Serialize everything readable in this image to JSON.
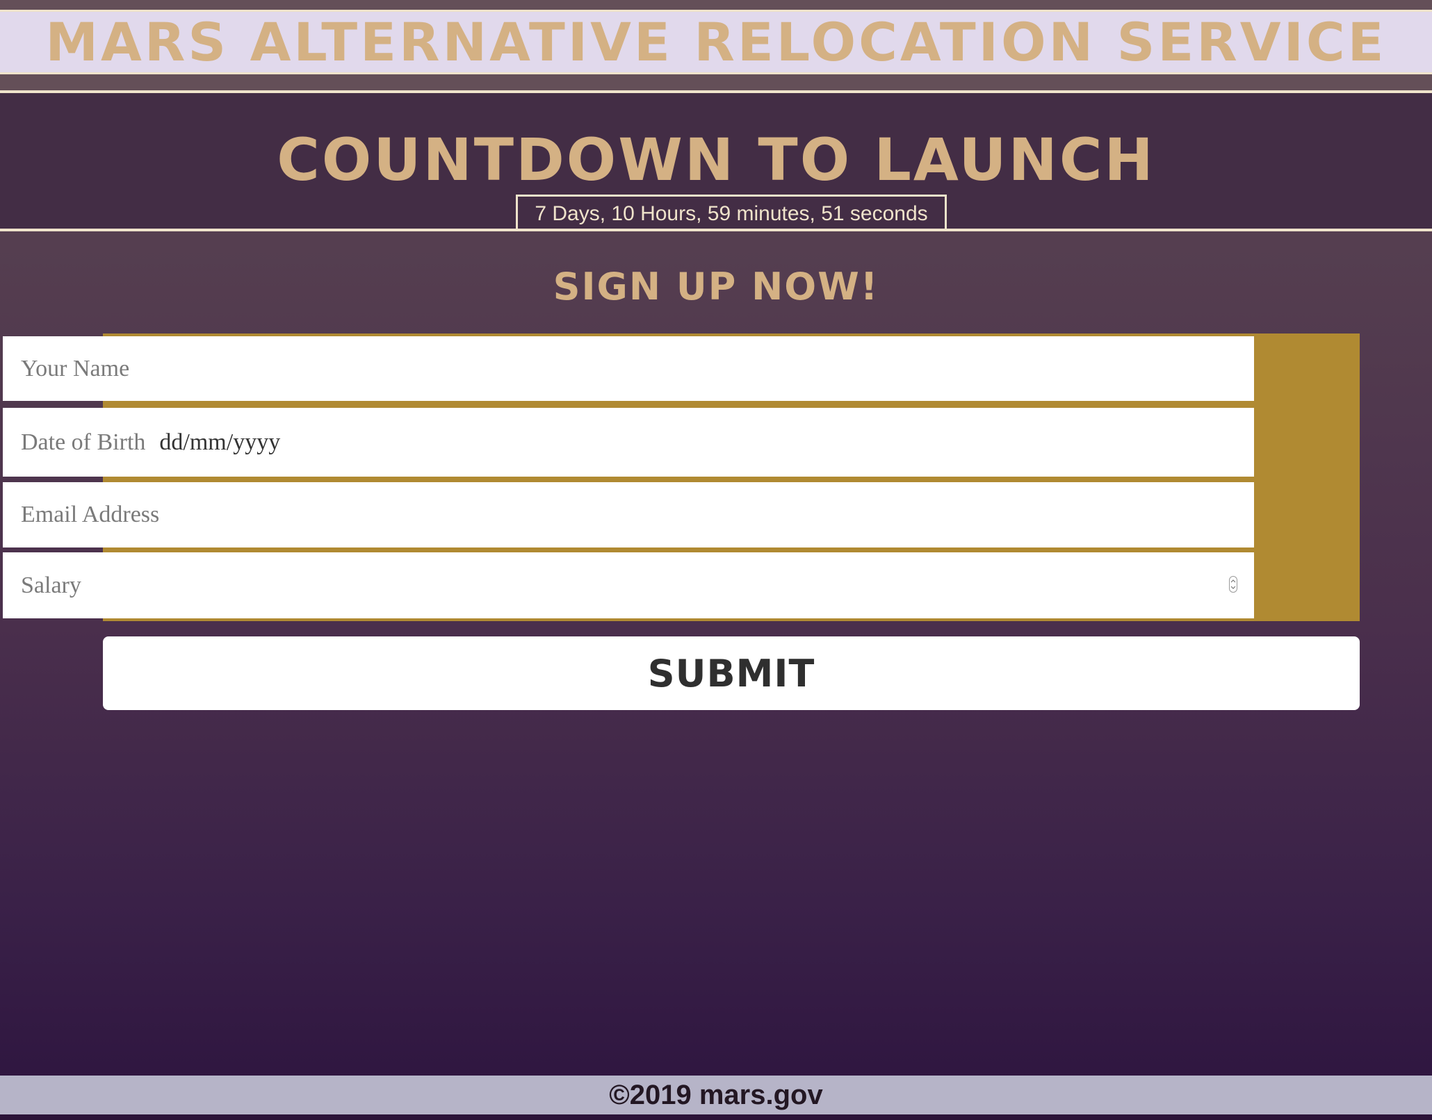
{
  "header": {
    "title": "MARS ALTERNATIVE RELOCATION SERVICE"
  },
  "countdown": {
    "title": "COUNTDOWN TO LAUNCH",
    "timer": "7 Days, 10 Hours, 59 minutes, 51 seconds"
  },
  "signup": {
    "title": "SIGN UP NOW!",
    "fields": {
      "name_placeholder": "Your Name",
      "dob_label": "Date of Birth",
      "dob_format": "dd/mm/yyyy",
      "email_placeholder": "Email Address",
      "salary_placeholder": "Salary"
    },
    "submit_label": "SUBMIT"
  },
  "footer": {
    "text": "©2019 mars.gov"
  },
  "colors": {
    "accent_gold": "#d4b184",
    "border_gold": "#b08a32",
    "header_band": "#e1d9ec",
    "footer_band": "#b6b4c8",
    "background_top": "#5c4852",
    "background_bottom": "#2c1438"
  },
  "icons": {
    "salary_stepper": "number-stepper-icon"
  }
}
